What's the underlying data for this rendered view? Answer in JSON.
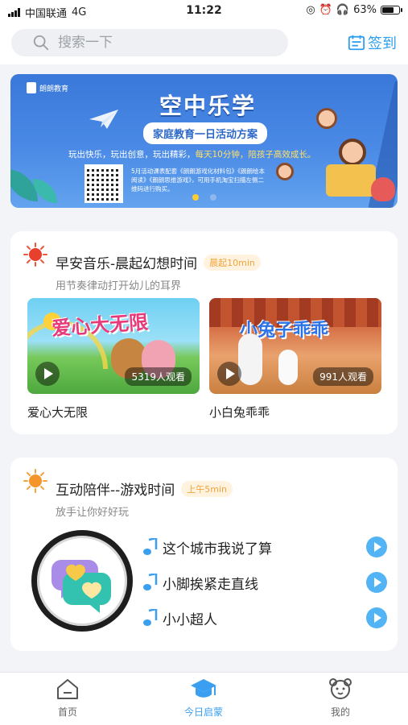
{
  "status_bar": {
    "carrier": "中国联通",
    "network": "4G",
    "time": "11:22",
    "battery": "63%"
  },
  "header": {
    "search_placeholder": "搜索一下",
    "checkin_label": "签到"
  },
  "banner": {
    "brand": "朗朗教育",
    "title": "空中乐学",
    "subtitle": "家庭教育一日活动方案",
    "slogan_a": "玩出快乐，玩出创意，玩出精彩，",
    "slogan_b": "每天10分钟，陪孩子高效成长。",
    "note": "5月活动课表配套《朗朗游戏化材料包》《朗朗绘本阅读》《朗朗思维游戏》，可用手机淘宝扫描左侧二维码进行购买。",
    "current_slide": 1,
    "total_slides": 2
  },
  "section_morning": {
    "title": "早安音乐-晨起幻想时间",
    "tag": "晨起10min",
    "subtitle": "用节奏律动打开幼儿的耳界",
    "videos": [
      {
        "art_text": "爱心大无限",
        "views": "5319人观看",
        "caption": "爱心大无限"
      },
      {
        "art_text": "小兔子乖乖",
        "views": "991人观看",
        "caption": "小白兔乖乖"
      }
    ]
  },
  "section_interactive": {
    "title": "互动陪伴--游戏时间",
    "tag": "上午5min",
    "subtitle": "放手让你好好玩",
    "songs": [
      {
        "name": "这个城市我说了算"
      },
      {
        "name": "小脚挨紧走直线"
      },
      {
        "name": "小小超人"
      }
    ]
  },
  "tabbar": {
    "items": [
      {
        "label": "首页",
        "icon": "home-icon",
        "active": false
      },
      {
        "label": "今日启蒙",
        "icon": "graduation-cap-icon",
        "active": true
      },
      {
        "label": "我的",
        "icon": "bear-face-icon",
        "active": false
      }
    ]
  },
  "colors": {
    "accent": "#3a9ff0",
    "tag_text": "#f0a43a",
    "play_button": "#52b4f5"
  }
}
